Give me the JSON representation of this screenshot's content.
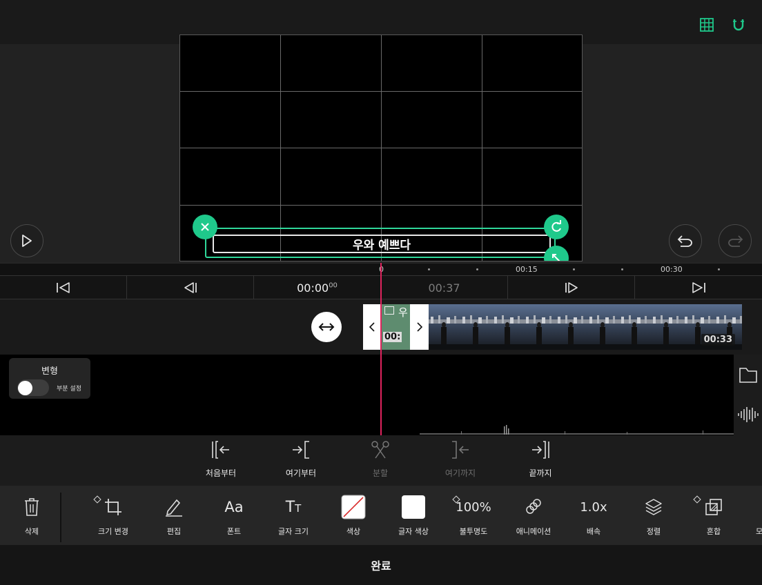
{
  "colors": {
    "accent": "#1fc98b",
    "playhead": "#e0245e",
    "background": "#1c1c1c",
    "canvas": "#000000"
  },
  "topbar": {
    "grid_icon": "grid-icon",
    "magnet_icon": "magnet-icon"
  },
  "preview": {
    "caption_text": "우와 예쁘다"
  },
  "ruler": {
    "labels": [
      "0",
      "00:15",
      "00:30"
    ]
  },
  "transport": {
    "current_time": "00:00",
    "current_frames": "00",
    "total_time": "00:37"
  },
  "timeline": {
    "clip_duration": "00:33",
    "text_clip_label": "우",
    "text_clip_time": "00:"
  },
  "transform": {
    "title": "변형",
    "partial_label": "부분 설정"
  },
  "trim": {
    "items": [
      {
        "label": "처음부터"
      },
      {
        "label": "여기부터"
      },
      {
        "label": "분할"
      },
      {
        "label": "여기까지"
      },
      {
        "label": "끝까지"
      }
    ]
  },
  "tools": {
    "delete": "삭제",
    "resize": "크기 변경",
    "edit": "편집",
    "font": "폰트",
    "text_size": "글자 크기",
    "color": "색상",
    "text_color": "글자 색상",
    "opacity": "불투명도",
    "opacity_value": "100%",
    "animation": "애니메이션",
    "speed": "배속",
    "speed_value": "1.0x",
    "arrange": "정렬",
    "blend": "혼합",
    "more_partial": "모"
  },
  "footer": {
    "done": "완료"
  }
}
